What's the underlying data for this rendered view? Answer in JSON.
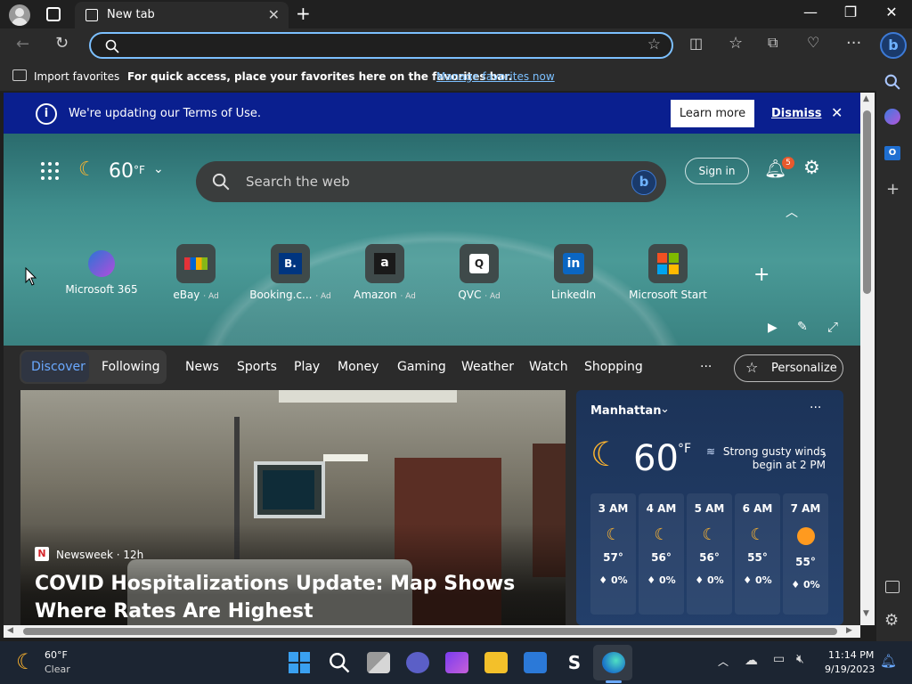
{
  "browser": {
    "tab_title": "New tab",
    "address_value": "",
    "favorites_bar": {
      "import_label": "Import favorites",
      "hint": "For quick access, place your favorites here on the favorites bar.",
      "manage_link": "Manage favorites now"
    }
  },
  "banner": {
    "message": "We're updating our Terms of Use.",
    "learn_more": "Learn more",
    "dismiss": "Dismiss"
  },
  "header": {
    "weather_temp": "60",
    "weather_unit": "°F",
    "search_placeholder": "Search the web",
    "sign_in": "Sign in",
    "notification_count": "5"
  },
  "quick_links": [
    {
      "label": "Microsoft 365",
      "ad": "",
      "icon": "M"
    },
    {
      "label": "eBay",
      "ad": "· Ad",
      "icon": "e"
    },
    {
      "label": "Booking.c...",
      "ad": "· Ad",
      "icon": "B."
    },
    {
      "label": "Amazon",
      "ad": "· Ad",
      "icon": "a"
    },
    {
      "label": "QVC",
      "ad": "· Ad",
      "icon": "Q"
    },
    {
      "label": "LinkedIn",
      "ad": "",
      "icon": "in"
    },
    {
      "label": "Microsoft Start",
      "ad": "",
      "icon": "⊞"
    }
  ],
  "feed_tabs": {
    "discover": "Discover",
    "following": "Following",
    "items": [
      "News",
      "Sports",
      "Play",
      "Money",
      "Gaming",
      "Weather",
      "Watch",
      "Shopping"
    ],
    "more": "···",
    "personalize": "Personalize"
  },
  "article": {
    "source_logo": "N",
    "source": "Newsweek · 12h",
    "headline": "COVID Hospitalizations Update: Map Shows Where Rates Are Highest"
  },
  "weather_card": {
    "location": "Manhattan",
    "temp": "60",
    "unit": "°F",
    "alert": "Strong gusty winds begin at 2 PM",
    "hours": [
      {
        "time": "3 AM",
        "temp": "57°",
        "precip": "0%",
        "icon": "moon"
      },
      {
        "time": "4 AM",
        "temp": "56°",
        "precip": "0%",
        "icon": "moon"
      },
      {
        "time": "5 AM",
        "temp": "56°",
        "precip": "0%",
        "icon": "moon"
      },
      {
        "time": "6 AM",
        "temp": "55°",
        "precip": "0%",
        "icon": "moon"
      },
      {
        "time": "7 AM",
        "temp": "55°",
        "precip": "0%",
        "icon": "sun"
      }
    ]
  },
  "taskbar": {
    "weather_temp": "60°F",
    "weather_cond": "Clear",
    "time": "11:14 PM",
    "date": "9/19/2023"
  },
  "colors": {
    "banner": "#0a1f8f",
    "accent": "#7cc0ff",
    "discover": "#6aa9ff",
    "badge": "#e8592d"
  }
}
